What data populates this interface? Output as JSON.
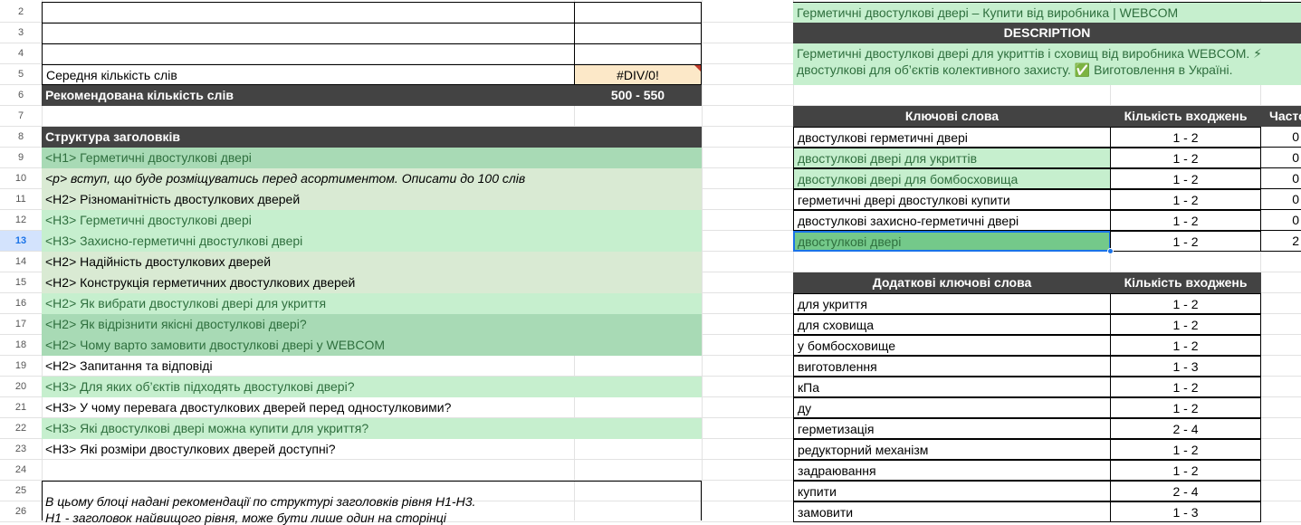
{
  "row_numbers": [
    "2",
    "3",
    "4",
    "5",
    "6",
    "7",
    "8",
    "9",
    "10",
    "11",
    "12",
    "13",
    "14",
    "15",
    "16",
    "17",
    "18",
    "19",
    "20",
    "21",
    "22",
    "23",
    "24",
    "25",
    "26"
  ],
  "active_row": "13",
  "left": {
    "avg_words_label": "Середня кількість слів",
    "avg_words_value": "#DIV/0!",
    "rec_words_label": "Рекомендована кількість слів",
    "rec_words_value": "500 - 550",
    "structure_header": "Структура заголовків",
    "headings": [
      "<H1> Герметичні двостулкові двері",
      "<p> вступ, що буде розміщуватись перед асортиментом. Описати до 100 слів",
      "<H2> Різноманітність двостулкових дверей",
      "<H3> Герметичні двостулкові двері",
      "<H3> Захисно-герметичні двостулкові двері",
      "<H2> Надійність двостулкових дверей",
      "<H2> Конструкція герметичних двостулкових дверей",
      "<H2> Як вибрати двостулкові двері для укриття",
      "<H2> Як відрізнити якісні двостулкові двері?",
      "<H2> Чому варто замовити двостулкові двері у WEBCOM",
      "<H2> Запитання та відповіді",
      "<H3> Для яких об’єктів підходять двостулкові двері?",
      "<H3> У чому перевага двостулкових дверей перед одностулковими?",
      "<H3> Які двостулкові двері можна купити для укриття?",
      "<H3> Які розміри двостулкових дверей доступні?"
    ],
    "note_line1": "В цьому блоці надані рекомендації по структурі заголовків рівня Н1-Н3.",
    "note_line2": "Н1 - заголовок найвищого рівня, може бути лише один на сторінці"
  },
  "right": {
    "title_value": "Герметичні двостулкові двері – Купити від виробника | WEBCOM",
    "description_header": "DESCRIPTION",
    "description_line1": "Герметичні двостулкові двері для укриттів і сховищ від виробника WEBCOM. ⚡",
    "description_line2": "двостулкові для об’єктів колективного захисту. ✅ Виготовлення в Україні.",
    "kw_header": "Ключові слова",
    "count_header": "Кількість входжень",
    "freq_header": "Часто",
    "keywords": [
      {
        "kw": "двостулкові герметичні двері",
        "count": "1 - 2",
        "freq": "0"
      },
      {
        "kw": "двостулкові двері для укриттів",
        "count": "1 - 2",
        "freq": "0"
      },
      {
        "kw": "двостулкові двері для бомбосховища",
        "count": "1 - 2",
        "freq": "0"
      },
      {
        "kw": "герметичні двері двостулкові купити",
        "count": "1 - 2",
        "freq": "0"
      },
      {
        "kw": "двостулкові захисно-герметичні двері",
        "count": "1 - 2",
        "freq": "0"
      },
      {
        "kw": "двостулкові двері",
        "count": "1 - 2",
        "freq": "2"
      }
    ],
    "extra_header": "Додаткові ключові слова",
    "extra_count_header": "Кількість входжень",
    "extra": [
      {
        "kw": "для укриття",
        "count": "1 - 2"
      },
      {
        "kw": "для сховища",
        "count": "1 - 2"
      },
      {
        "kw": "у бомбосховище",
        "count": "1 - 2"
      },
      {
        "kw": "виготовлення",
        "count": "1 - 3"
      },
      {
        "kw": "кПа",
        "count": "1 - 2"
      },
      {
        "kw": "ду",
        "count": "1 - 2"
      },
      {
        "kw": "герметизація",
        "count": "2 - 4"
      },
      {
        "kw": "редукторний механізм",
        "count": "1 - 2"
      },
      {
        "kw": "задраювання",
        "count": "1 - 2"
      },
      {
        "kw": "купити",
        "count": "2 - 4"
      },
      {
        "kw": "замовити",
        "count": "1 - 3"
      }
    ]
  },
  "colors": {
    "dark_header": "#434343",
    "green_strong": "#a8dab5",
    "green_soft": "#d9ead3",
    "green_light": "#c6efce",
    "error_cell": "#fce8c8",
    "selection": "#1a73e8"
  }
}
